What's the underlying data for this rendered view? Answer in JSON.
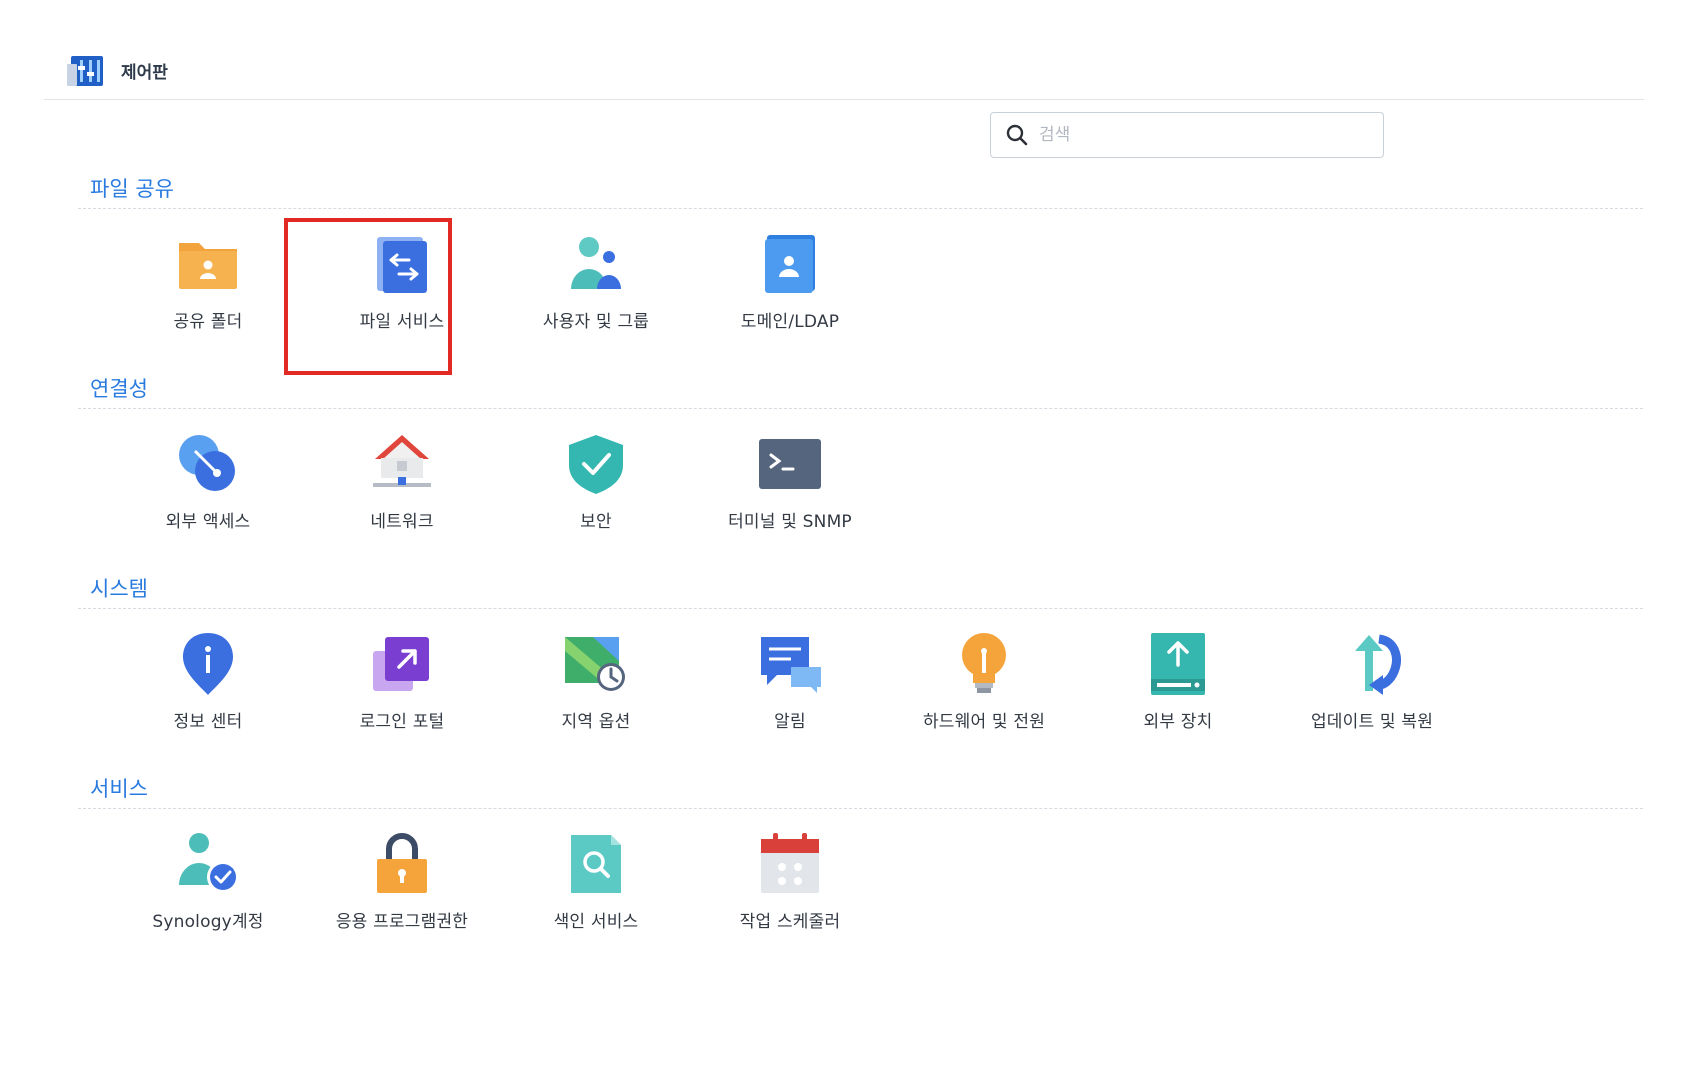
{
  "header": {
    "title": "제어판",
    "app_icon": "control-panel-icon"
  },
  "search": {
    "placeholder": "검색",
    "value": ""
  },
  "sections": [
    {
      "title": "파일 공유",
      "items": [
        {
          "label": "공유 폴더",
          "icon": "shared-folder-icon"
        },
        {
          "label": "파일 서비스",
          "icon": "file-services-icon",
          "highlighted": true
        },
        {
          "label": "사용자 및 그룹",
          "icon": "user-group-icon"
        },
        {
          "label": "도메인/LDAP",
          "icon": "domain-ldap-icon"
        }
      ]
    },
    {
      "title": "연결성",
      "items": [
        {
          "label": "외부 액세스",
          "icon": "external-access-icon"
        },
        {
          "label": "네트워크",
          "icon": "network-icon"
        },
        {
          "label": "보안",
          "icon": "security-shield-icon"
        },
        {
          "label": "터미널 및 SNMP",
          "icon": "terminal-icon"
        }
      ]
    },
    {
      "title": "시스템",
      "items": [
        {
          "label": "정보 센터",
          "icon": "info-center-icon"
        },
        {
          "label": "로그인 포털",
          "icon": "login-portal-icon"
        },
        {
          "label": "지역 옵션",
          "icon": "regional-options-icon"
        },
        {
          "label": "알림",
          "icon": "notification-icon"
        },
        {
          "label": "하드웨어 및 전원",
          "icon": "hardware-power-icon"
        },
        {
          "label": "외부 장치",
          "icon": "external-device-icon"
        },
        {
          "label": "업데이트 및 복원",
          "icon": "update-restore-icon"
        }
      ]
    },
    {
      "title": "서비스",
      "items": [
        {
          "label": "Synology계정",
          "icon": "synology-account-icon"
        },
        {
          "label": "응용 프로그램권한",
          "icon": "app-privileges-icon"
        },
        {
          "label": "색인 서비스",
          "icon": "indexing-service-icon"
        },
        {
          "label": "작업 스케줄러",
          "icon": "task-scheduler-icon"
        }
      ]
    }
  ],
  "colors": {
    "accent": "#2a7be0",
    "highlight_border": "#e02a23"
  }
}
